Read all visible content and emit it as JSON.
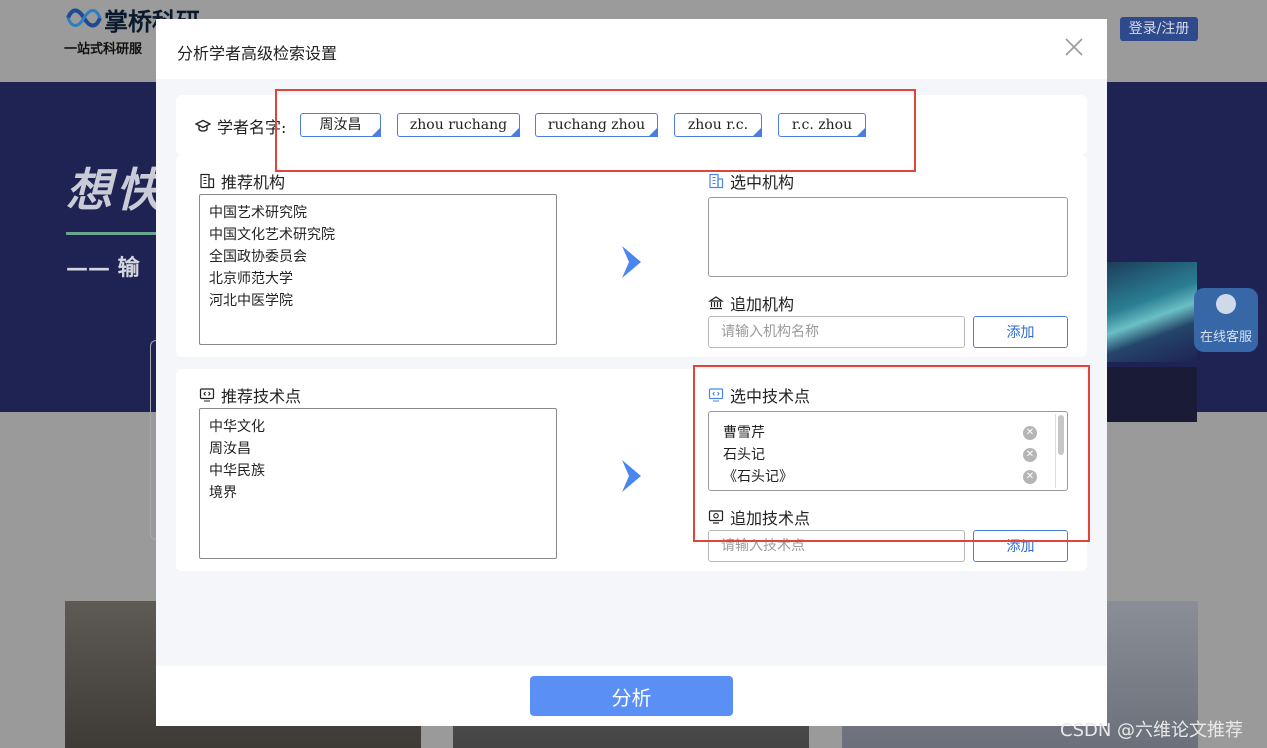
{
  "background": {
    "logo_title": "掌桥科研",
    "logo_subtitle": "一站式科研服",
    "login_button": "登录/注册",
    "hero_text": "想快",
    "hero_sub": "—— 输",
    "online_service": "在线客服",
    "watermark": "CSDN @六维论文推荐"
  },
  "modal": {
    "title": "分析学者高级检索设置",
    "close_icon": "close-icon",
    "scholar": {
      "label": "学者名字:",
      "icon": "graduation-cap-icon",
      "names": [
        "周汝昌",
        "zhou ruchang",
        "ruchang zhou",
        "zhou r.c.",
        "r.c. zhou"
      ]
    },
    "institutions": {
      "recommended_label": "推荐机构",
      "recommended_icon": "building-icon",
      "recommended": [
        "中国艺术研究院",
        "中国文化艺术研究院",
        "全国政协委员会",
        "北京师范大学",
        "河北中医学院"
      ],
      "selected_label": "选中机构",
      "selected_icon": "building-icon",
      "selected": [],
      "add_label": "追加机构",
      "add_icon": "bank-icon",
      "add_placeholder": "请输入机构名称",
      "add_button": "添加"
    },
    "tech": {
      "recommended_label": "推荐技术点",
      "recommended_icon": "monitor-code-icon",
      "recommended": [
        "中华文化",
        "周汝昌",
        "中华民族",
        "境界"
      ],
      "selected_label": "选中技术点",
      "selected_icon": "monitor-code-icon",
      "selected": [
        "曹雪芹",
        "石头记",
        "《石头记》"
      ],
      "add_label": "追加技术点",
      "add_icon": "monitor-plus-icon",
      "add_placeholder": "请输入技术点",
      "add_button": "添加"
    },
    "analyze_button": "分析"
  },
  "colors": {
    "accent": "#5a8ff5",
    "tag_border": "#4a7ee0",
    "highlight_box": "#e0443a",
    "hero_bg": "#1e2354"
  }
}
